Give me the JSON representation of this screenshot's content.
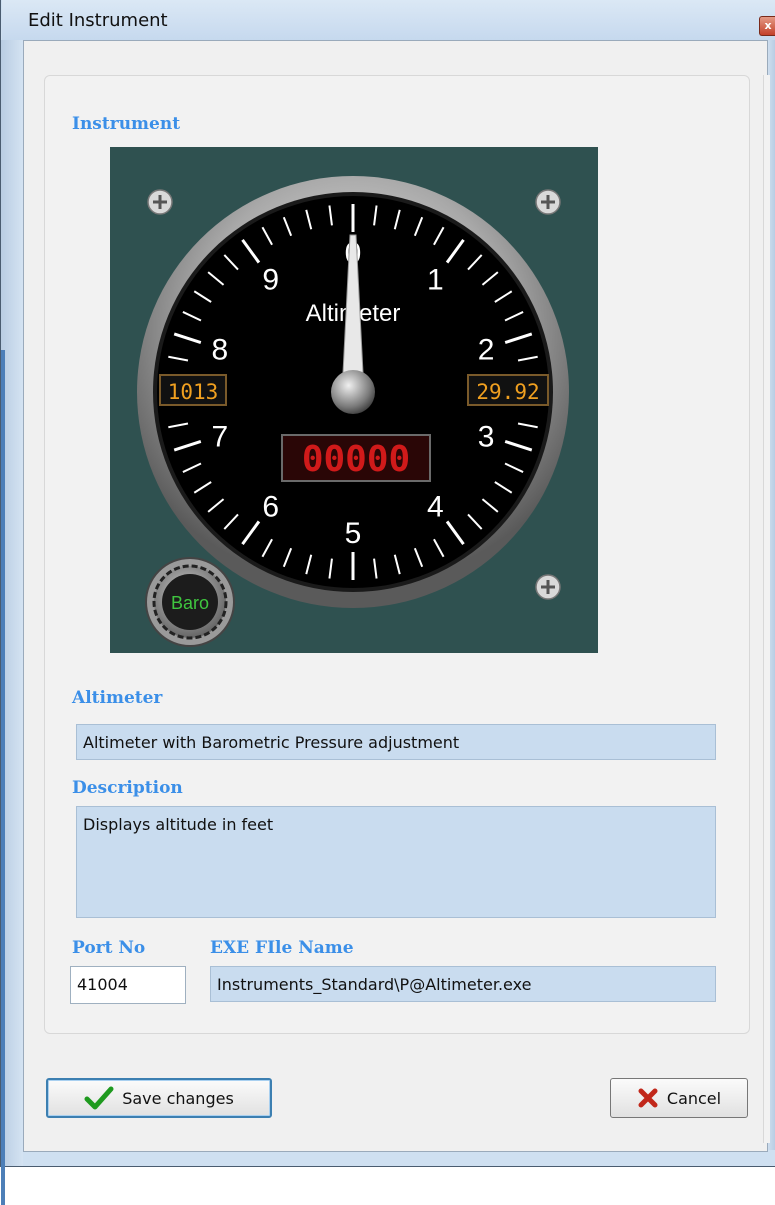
{
  "window": {
    "title": "Edit Instrument",
    "close_glyph": "x"
  },
  "sections": {
    "instrument": "Instrument",
    "name": "Altimeter",
    "description": "Description",
    "port": "Port No",
    "exe": "EXE FIle Name"
  },
  "gauge": {
    "dial_numbers": [
      "0",
      "1",
      "2",
      "3",
      "4",
      "5",
      "6",
      "7",
      "8",
      "9"
    ],
    "label": "Altimeter",
    "left_readout": "1013",
    "right_readout": "29.92",
    "center_readout": "00000",
    "knob_label": "Baro",
    "colors": {
      "background": "#2f5150",
      "dial": "#000000",
      "amber_led": "#f0a020",
      "red_led": "#d01a1a",
      "knob_text": "#3fc63f"
    }
  },
  "fields": {
    "name_value": "Altimeter with Barometric Pressure adjustment",
    "description_value": "Displays altitude in feet",
    "port_value": "41004",
    "exe_value": "Instruments_Standard\\P@Altimeter.exe"
  },
  "buttons": {
    "save": "Save changes",
    "cancel": "Cancel"
  },
  "icons": {
    "save": "check-icon",
    "cancel": "x-icon",
    "close": "close-icon"
  }
}
